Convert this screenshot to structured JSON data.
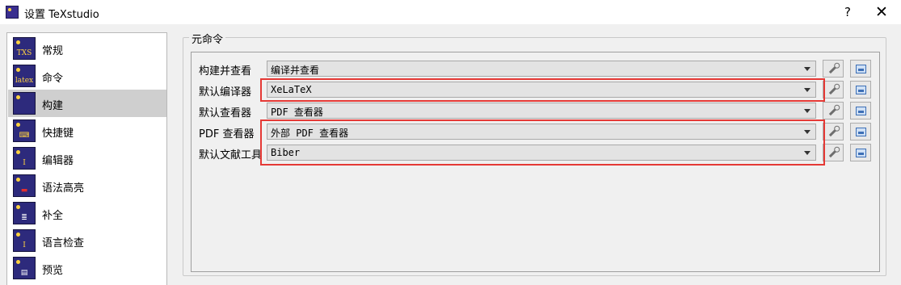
{
  "window": {
    "title": "设置 TeXstudio",
    "help_label": "?",
    "close_label": "✕"
  },
  "sidebar": {
    "items": [
      {
        "label": "常规",
        "icon": "txs-icon",
        "glyph": "TXS",
        "selected": false
      },
      {
        "label": "命令",
        "icon": "latex-icon",
        "glyph": "latex",
        "selected": false
      },
      {
        "label": "构建",
        "icon": "build-icon",
        "glyph": "",
        "selected": true
      },
      {
        "label": "快捷键",
        "icon": "keyboard-icon",
        "glyph": "⌨",
        "selected": false
      },
      {
        "label": "编辑器",
        "icon": "editor-cursor-icon",
        "glyph": "I",
        "selected": false
      },
      {
        "label": "语法高亮",
        "icon": "syntax-highlight-icon",
        "glyph": "▬",
        "selected": false
      },
      {
        "label": "补全",
        "icon": "completion-icon",
        "glyph": "≣",
        "selected": false
      },
      {
        "label": "语言检查",
        "icon": "language-check-icon",
        "glyph": "I",
        "selected": false
      },
      {
        "label": "预览",
        "icon": "preview-icon",
        "glyph": "▤",
        "selected": false
      }
    ]
  },
  "meta_commands": {
    "group_title": "元命令",
    "rows": [
      {
        "label": "构建并查看",
        "value": "编译并查看"
      },
      {
        "label": "默认编译器",
        "value": "XeLaTeX"
      },
      {
        "label": "默认查看器",
        "value": "PDF 查看器"
      },
      {
        "label": "PDF 查看器",
        "value": "外部 PDF 查看器"
      },
      {
        "label": "默认文献工具",
        "value": "Biber"
      }
    ]
  },
  "colors": {
    "highlight_box": "#e53935",
    "selected_item": "#cfcfcf"
  }
}
